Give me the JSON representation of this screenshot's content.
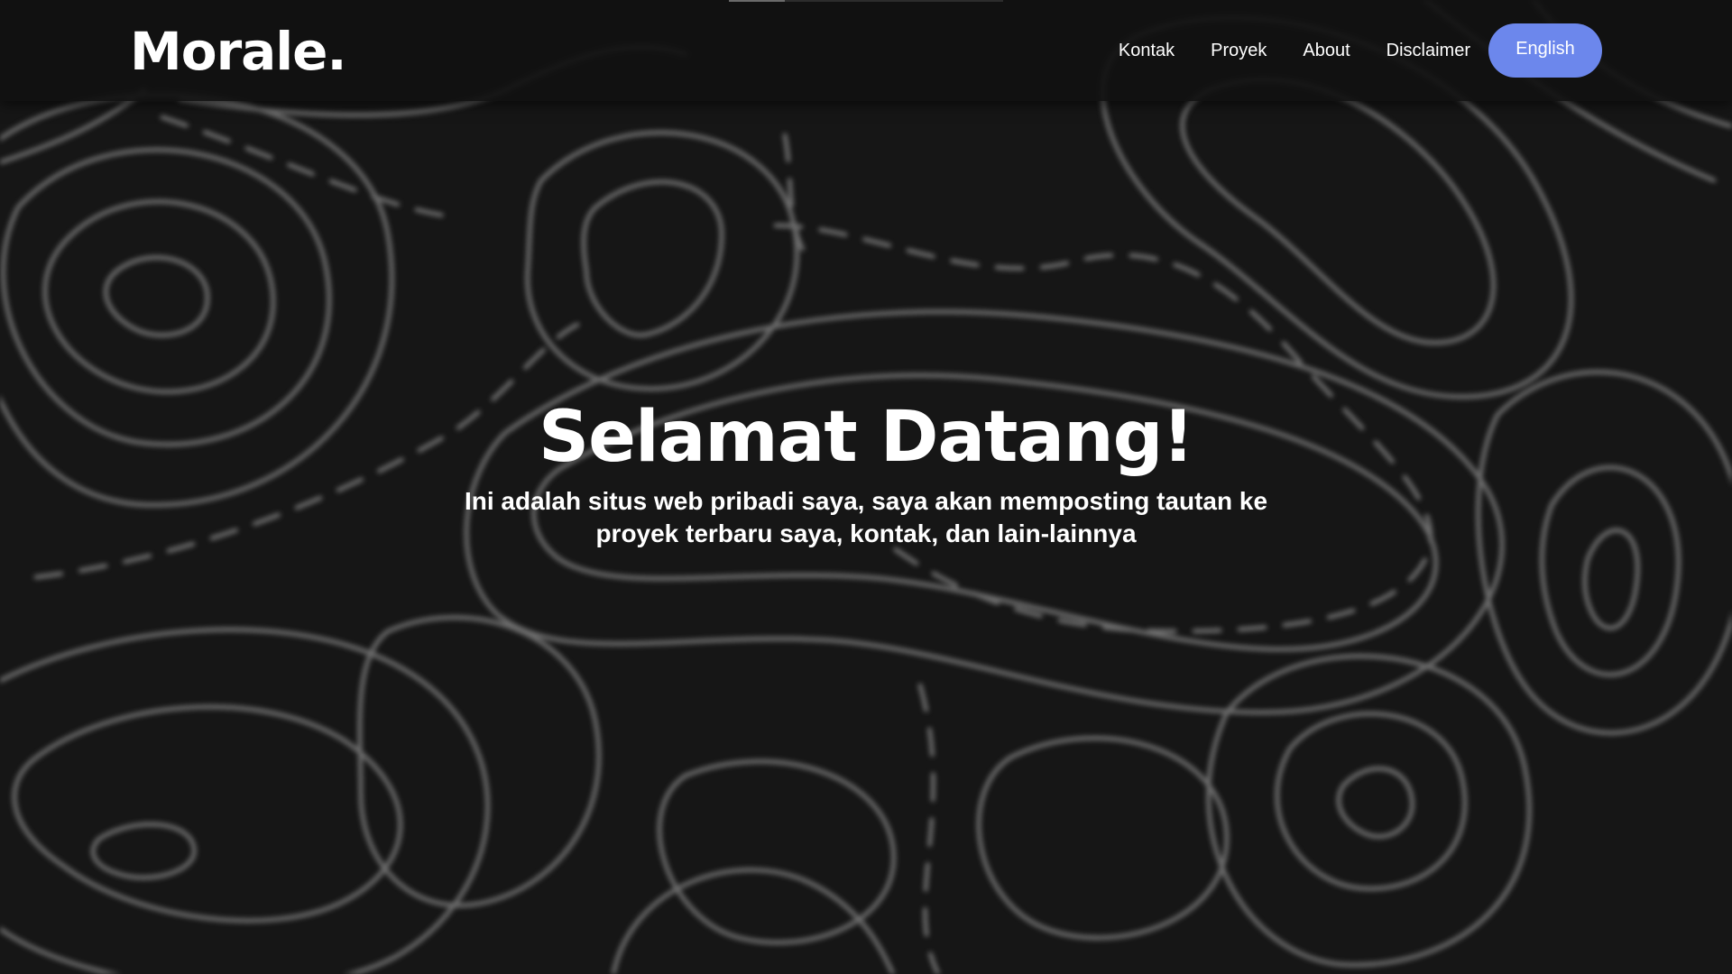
{
  "header": {
    "logo": "Morale.",
    "nav": [
      {
        "label": "Kontak"
      },
      {
        "label": "Proyek"
      },
      {
        "label": "About"
      },
      {
        "label": "Disclaimer"
      }
    ],
    "language_button": "English"
  },
  "hero": {
    "title": "Selamat Datang!",
    "subtitle": "Ini adalah situs web pribadi saya, saya akan memposting tautan ke proyek terbaru saya, kontak, dan lain-lainnya"
  },
  "colors": {
    "background": "#161616",
    "header": "#111111",
    "accent": "#6c87ec",
    "text": "#ffffff",
    "contour": "#9a9a9a"
  }
}
